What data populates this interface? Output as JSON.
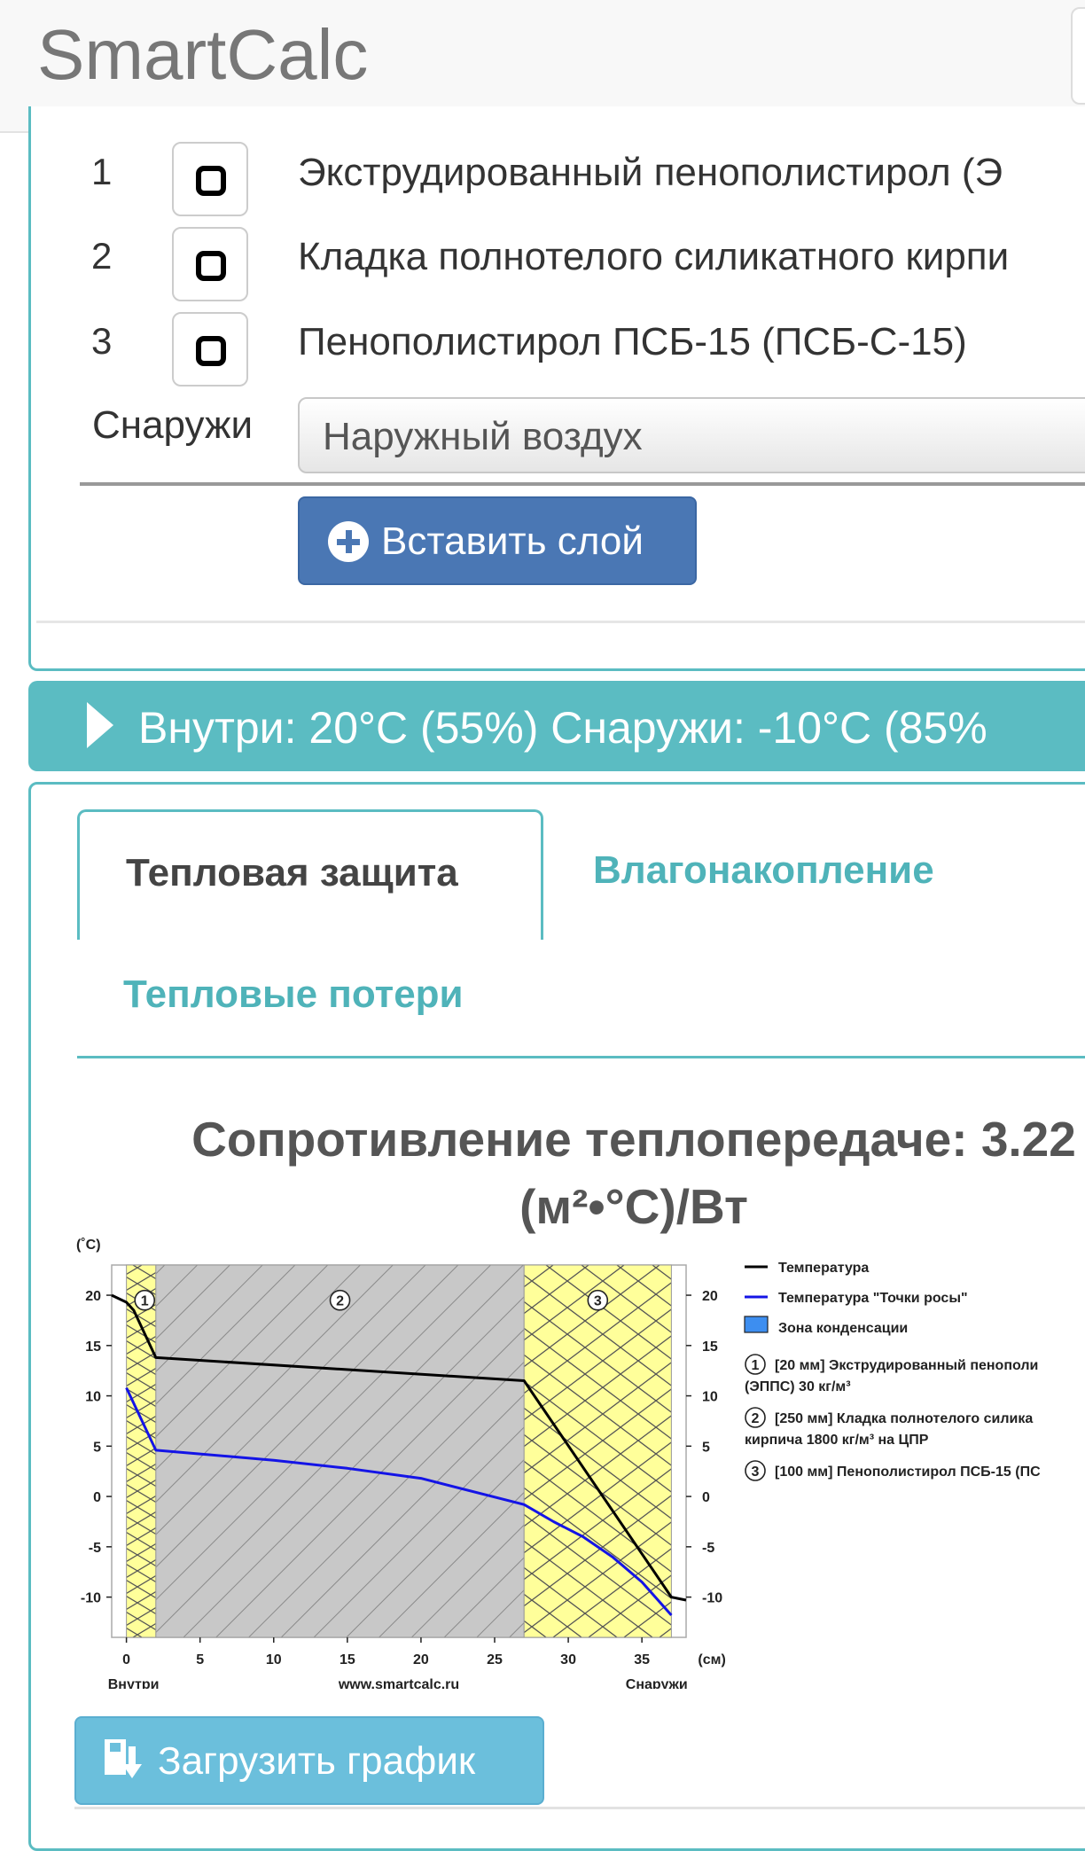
{
  "header": {
    "brand": "SmartCalc"
  },
  "layers": [
    {
      "num": "1",
      "name": "Экструдированный пенополистирол (Э"
    },
    {
      "num": "2",
      "name": "Кладка полнотелого силикатного кирпи"
    },
    {
      "num": "3",
      "name": "Пенополистирол ПСБ-15 (ПСБ-С-15)"
    }
  ],
  "outside": {
    "label": "Снаружи",
    "select_value": "Наружный воздух"
  },
  "insert_button": {
    "label": "Вставить слой",
    "icon": "plus-circle-icon"
  },
  "conditions": {
    "text": "Внутри: 20°C (55%) Снаружи: -10°C (85%"
  },
  "tabs": [
    {
      "label": "Тепловая защита",
      "active": true
    },
    {
      "label": "Влагонакопление",
      "active": false
    },
    {
      "label": "Тепловые потери",
      "active": false
    }
  ],
  "result": {
    "line1": "Сопротивление теплопередаче: 3.22",
    "line2": "(м²•°С)/Вт"
  },
  "chart_data": {
    "type": "line",
    "y_unit": "(˚C)",
    "x_unit": "(см)",
    "xlim": [
      -1,
      38
    ],
    "ylim": [
      -14,
      23
    ],
    "x_ticks": [
      0,
      5,
      10,
      15,
      20,
      25,
      30,
      35
    ],
    "y_ticks": [
      20,
      15,
      10,
      5,
      0,
      -5,
      -10
    ],
    "x_labels": {
      "left": "Внутри",
      "center": "www.smartcalc.ru",
      "right": "Снаружи"
    },
    "layers": [
      {
        "id": "1",
        "from": 0,
        "to": 2
      },
      {
        "id": "2",
        "from": 2,
        "to": 27
      },
      {
        "id": "3",
        "from": 27,
        "to": 37
      }
    ],
    "series": [
      {
        "name": "Температура",
        "color": "#000000",
        "points": [
          [
            -1,
            20
          ],
          [
            0,
            19.3
          ],
          [
            0.5,
            18.5
          ],
          [
            2,
            13.8
          ],
          [
            27,
            11.5
          ],
          [
            37,
            -10
          ],
          [
            38,
            -10.3
          ]
        ]
      },
      {
        "name": "Температура \"Точки росы\"",
        "color": "#1414e6",
        "points": [
          [
            0,
            10.8
          ],
          [
            2,
            4.6
          ],
          [
            10,
            3.6
          ],
          [
            15,
            2.8
          ],
          [
            20,
            1.8
          ],
          [
            27,
            -0.8
          ],
          [
            29,
            -2.5
          ],
          [
            31,
            -4
          ],
          [
            33,
            -6
          ],
          [
            35,
            -8.5
          ],
          [
            37,
            -11.8
          ]
        ]
      }
    ],
    "legend": [
      {
        "kind": "line",
        "color": "#000000",
        "text": "Температура"
      },
      {
        "kind": "line",
        "color": "#1414e6",
        "text": "Температура \"Точки росы\""
      },
      {
        "kind": "box",
        "color": "#3d8ef0",
        "text": "Зона конденсации"
      },
      {
        "kind": "num",
        "num": "1",
        "text": "[20 мм] Экструдированный пенополи",
        "text2": "(ЭППС) 30 кг/м³"
      },
      {
        "kind": "num",
        "num": "2",
        "text": "[250 мм] Кладка полнотелого силика",
        "text2": "кирпича 1800 кг/м³ на ЦПР"
      },
      {
        "kind": "num",
        "num": "3",
        "text": "[100 мм] Пенополистирол ПСБ-15 (ПС",
        "text2": ""
      }
    ]
  },
  "download_button": {
    "label": "Загрузить график",
    "icon": "download-icon"
  }
}
